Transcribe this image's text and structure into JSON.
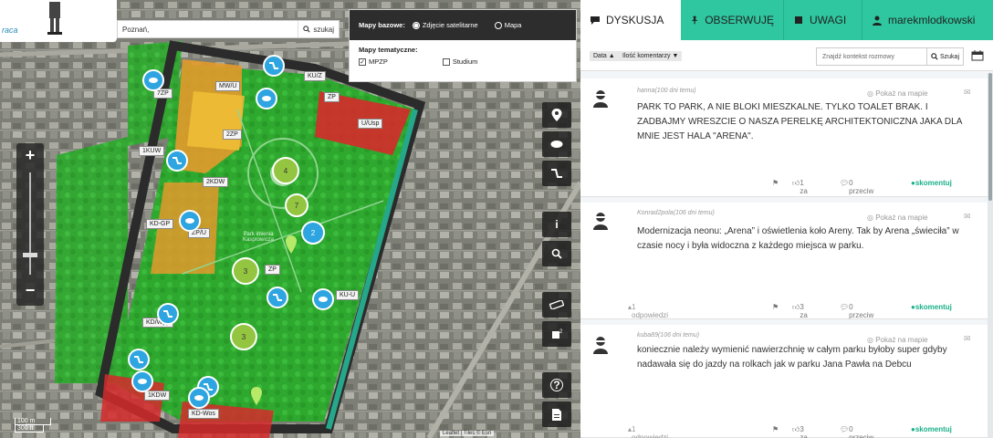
{
  "header": {
    "logo_text": "raca"
  },
  "map": {
    "search": {
      "placeholder": "Poznań,",
      "button": "szukaj"
    },
    "base_maps": {
      "label": "Mapy bazowe:",
      "options": [
        {
          "label": "Zdjęcie satelitarne",
          "selected": true
        },
        {
          "label": "Mapa",
          "selected": false
        }
      ]
    },
    "thematic_maps": {
      "label": "Mapy tematyczne:",
      "options": [
        {
          "label": "MPZP",
          "checked": true
        },
        {
          "label": "Studium",
          "checked": false
        }
      ]
    },
    "zoom": {
      "in": "+",
      "out": "−"
    },
    "tools": [
      "location-pin-icon",
      "speech-icon",
      "road-icon",
      "info-icon",
      "search-zoom-icon",
      "ruler-icon",
      "area-icon",
      "help-icon",
      "document-icon"
    ],
    "scale": [
      "100 m",
      "300 ft"
    ],
    "attribution": "Leaflet | Tiles © Esri",
    "park_label": "Park imienia Kasprowicza",
    "zones": [
      "7ZP",
      "MW/U",
      "KU/Z",
      "ZP",
      "U/Usp",
      "1KUW",
      "2KDW",
      "KD-GP",
      "ZP/U",
      "2ZP",
      "ZP",
      "KU-U",
      "KD/Wpp",
      "1KDW",
      "KD-Wos"
    ],
    "bubbles": {
      "green": [
        "4",
        "7",
        "3",
        "3"
      ],
      "blue": [
        "2"
      ]
    },
    "colors": {
      "park": "#2fb12f",
      "orange_zone": "#e8a030",
      "red_zone": "#d93030",
      "blue_marker": "#2ea5e0",
      "green_marker": "#93c541"
    }
  },
  "panel": {
    "tabs": [
      {
        "label": "DYSKUSJA",
        "icon": "chat-icon",
        "active": true
      },
      {
        "label": "OBSERWUJĘ",
        "icon": "pin-icon",
        "active": false
      },
      {
        "label": "UWAGI",
        "icon": "square-icon",
        "active": false
      },
      {
        "label": "marekmlodkowski",
        "icon": "user-icon",
        "active": false
      }
    ],
    "sort": {
      "date": "Data ▲",
      "count": "Ilość komentarzy ▼"
    },
    "context_search": {
      "placeholder": "Znajdź kontekst rozmowy",
      "button": "Szukaj"
    },
    "comments": [
      {
        "user": "hanna(100 dni temu)",
        "show_on_map": "Pokaż na mapie",
        "text": "PARK TO PARK, A NIE BLOKI MIESZKALNE. TYLKO TOALET BRAK. I ZADBAJMY WRESZCIE O NASZA PERELKĘ ARCHITEKTONICZNA JAKA DLA MNIE JEST HALA \"ARENA\".",
        "replies": "",
        "likes": "1 za",
        "dislikes": "0 przeciw",
        "reply_action": "skomentuj"
      },
      {
        "user": "Konrad2pola(106 dni temu)",
        "show_on_map": "Pokaż na mapie",
        "text": "Modernizacja neonu: „Arena” i oświetlenia koło Areny. Tak by Arena „świeciła” w czasie nocy i była widoczna z każdego miejsca w parku.",
        "replies": "1 odpowiedzi",
        "likes": "3 za",
        "dislikes": "0 przeciw",
        "reply_action": "skomentuj"
      },
      {
        "user": "kuba89(106 dni temu)",
        "show_on_map": "Pokaż na mapie",
        "text": "koniecznie należy wymienić nawierzchnię w całym parku byłoby super gdyby nadawała się do jazdy na rolkach jak w parku Jana Pawła na Debcu",
        "replies": "1 odpowiedzi",
        "likes": "3 za",
        "dislikes": "0 przeciw",
        "reply_action": "skomentuj"
      }
    ]
  }
}
